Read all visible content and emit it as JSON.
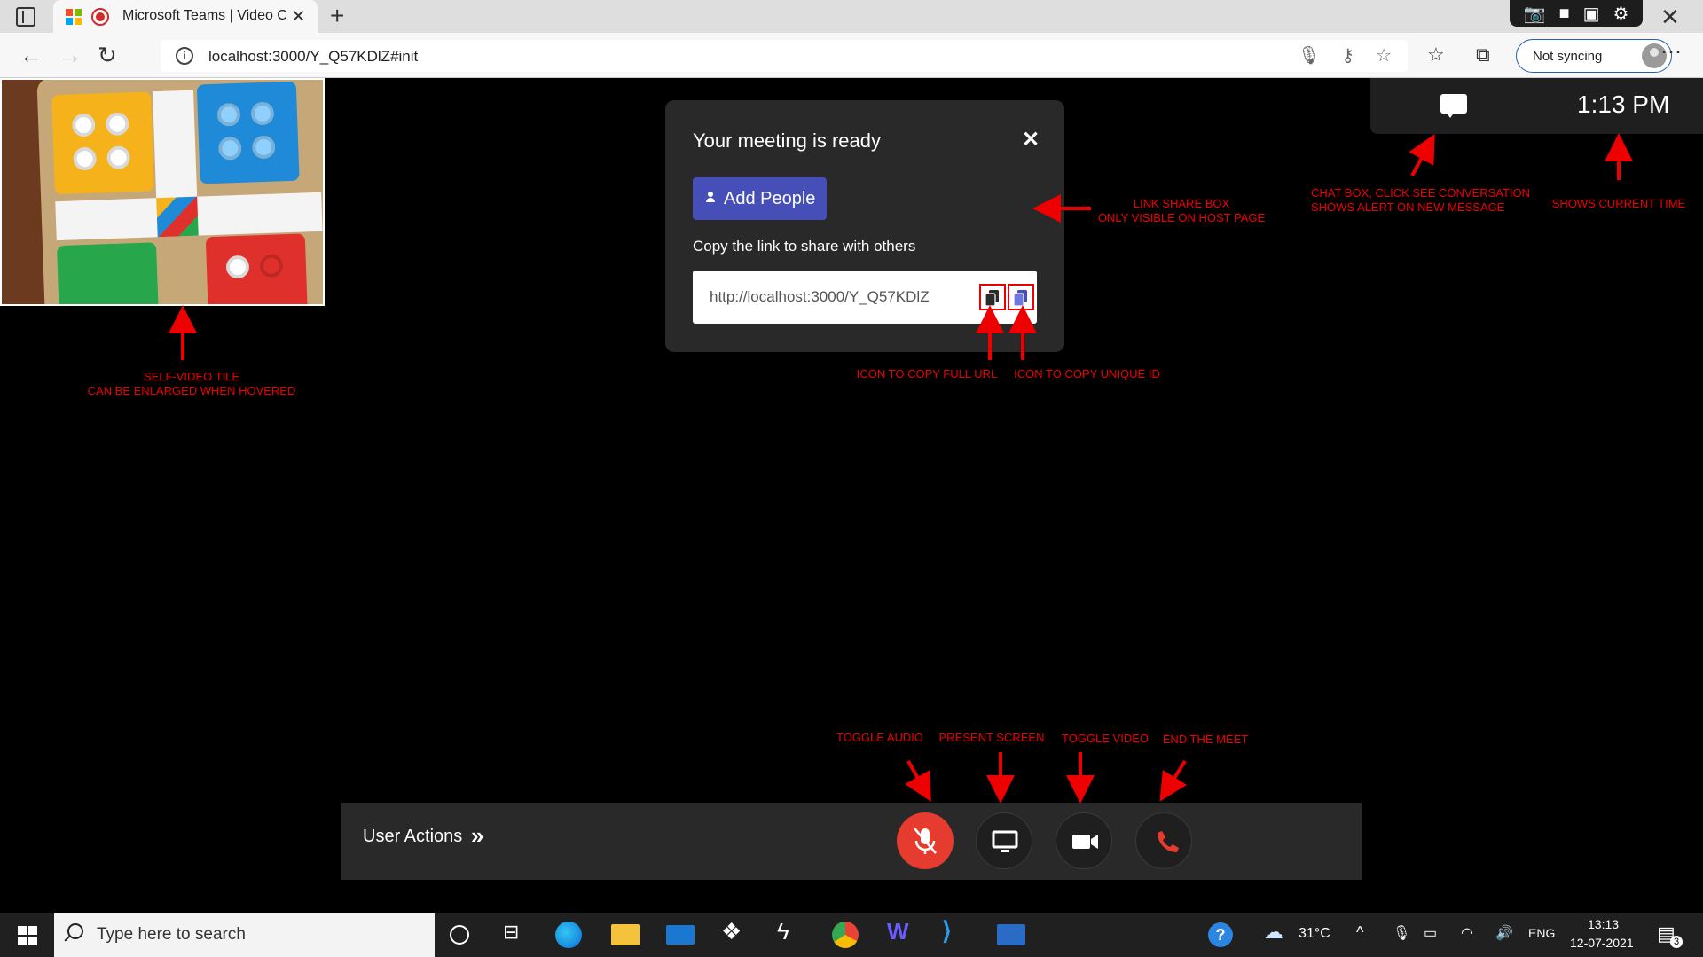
{
  "browser": {
    "tab_title": "Microsoft Teams | Video Co",
    "url": "localhost:3000/Y_Q57KDlZ#init",
    "sync_label": "Not syncing"
  },
  "meeting_card": {
    "title": "Your meeting is ready",
    "add_people_label": "Add People",
    "copy_hint": "Copy the link to share with others",
    "link": "http://localhost:3000/Y_Q57KDlZ"
  },
  "clock": "1:13 PM",
  "controls": {
    "user_actions_label": "User Actions",
    "user_actions_chevron": "»"
  },
  "annotations": {
    "link_share_box": [
      "LINK SHARE BOX",
      "ONLY VISIBLE ON HOST PAGE"
    ],
    "chat_box": [
      "CHAT BOX, CLICK SEE CONVERSATION",
      "SHOWS ALERT ON NEW MESSAGE"
    ],
    "current_time": "SHOWS CURRENT TIME",
    "self_video": [
      "SELF-VIDEO TILE",
      "CAN BE ENLARGED WHEN HOVERED"
    ],
    "copy_full_url": "ICON TO COPY FULL URL",
    "copy_unique_id": "ICON TO COPY UNIQUE ID",
    "toggle_audio": "TOGGLE AUDIO",
    "present_screen": "PRESENT SCREEN",
    "toggle_video": "TOGGLE VIDEO",
    "end_meet": "END THE MEET"
  },
  "taskbar": {
    "search_placeholder": "Type here to search",
    "temperature": "31°C",
    "language": "ENG",
    "time": "13:13",
    "date": "12-07-2021",
    "notification_count": "3"
  },
  "colors": {
    "accent": "#464eb8",
    "mic_off": "#e63c2f",
    "annotation": "#e00000",
    "panel": "#292929"
  }
}
